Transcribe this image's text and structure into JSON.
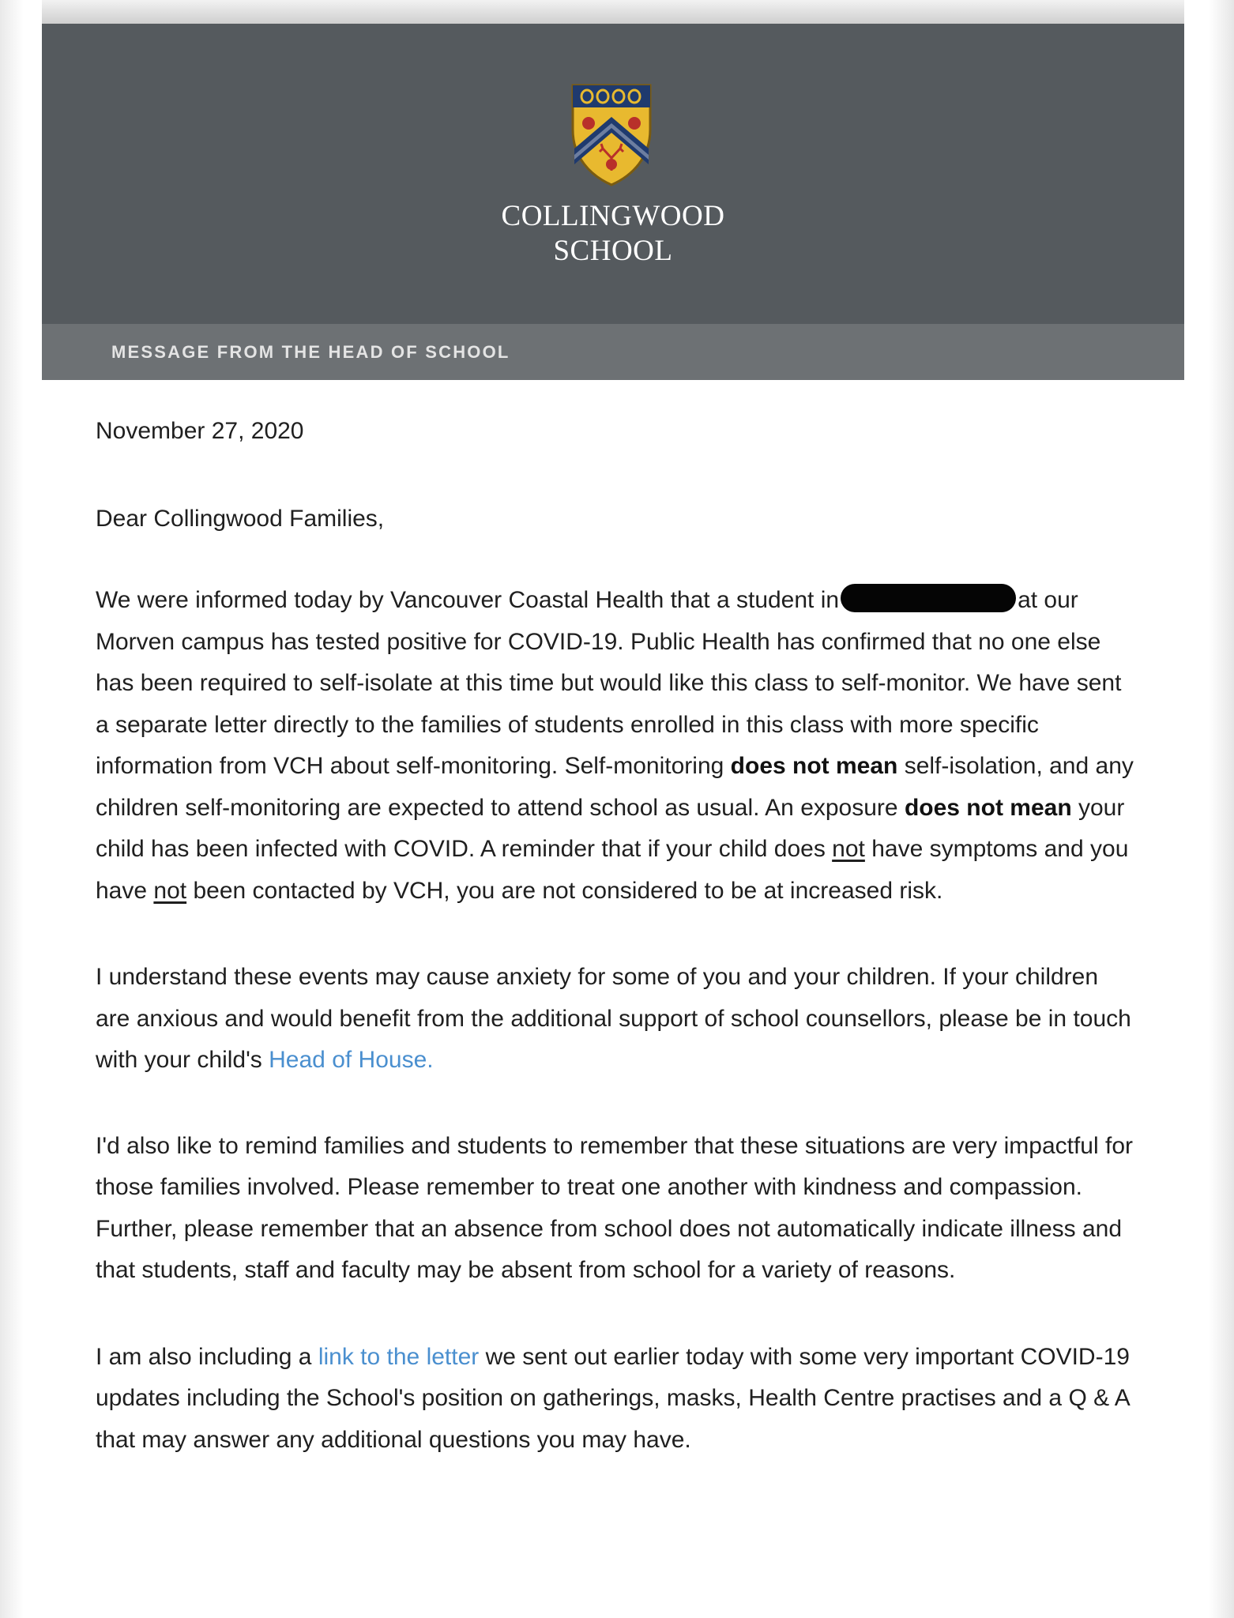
{
  "header": {
    "school_name_line1": "COLLINGWOOD",
    "school_name_line2": "SCHOOL",
    "crest_icon": "school-crest-icon",
    "subheader": "MESSAGE FROM THE HEAD OF SCHOOL",
    "colors": {
      "banner": "#555a5e",
      "subbanner": "#6d7174",
      "crest_gold": "#e8b92f",
      "crest_navy": "#1f3a6e"
    }
  },
  "letter": {
    "date": "November 27, 2020",
    "greeting": "Dear Collingwood Families,",
    "p1": {
      "a": "We were informed today by Vancouver Coastal Health that a student in",
      "b": "at our Morven campus has tested positive for COVID-19. Public Health has confirmed that no one else has been required to self-isolate at this time but would like this class to self-monitor. We have sent a separate letter directly to the families of students enrolled in this class with more specific information from VCH about self-monitoring. Self-monitoring ",
      "bold1": "does not mean",
      "c": " self-isolation, and any children self-monitoring are expected to attend school as usual. An exposure ",
      "bold2": "does not mean",
      "d": " your child has been infected with COVID. A reminder that if your child does ",
      "u1": "not",
      "e": " have symptoms and you have ",
      "u2": "not",
      "f": " been contacted by VCH, you are not considered to be at increased risk."
    },
    "p2": {
      "a": "I understand these events may cause anxiety for some of you and your children. If your children are anxious and would benefit from the additional support of school counsellors, please be in touch with your child's ",
      "link": "Head of House."
    },
    "p3": "I'd also like to remind families and students to remember that these situations are very impactful for those families involved. Please remember to treat one another with kindness and compassion. Further, please remember that an absence from school does not automatically indicate illness and that students, staff and faculty may be absent from school for a variety of reasons.",
    "p4": {
      "a": "I am also including a ",
      "link": "link to the letter",
      "b": " we sent out earlier today with some very important COVID-19 updates including the School's position on gatherings, masks, Health Centre practises and a Q & A that may answer any additional questions you may have."
    },
    "link_color": "#4a8fcf"
  }
}
